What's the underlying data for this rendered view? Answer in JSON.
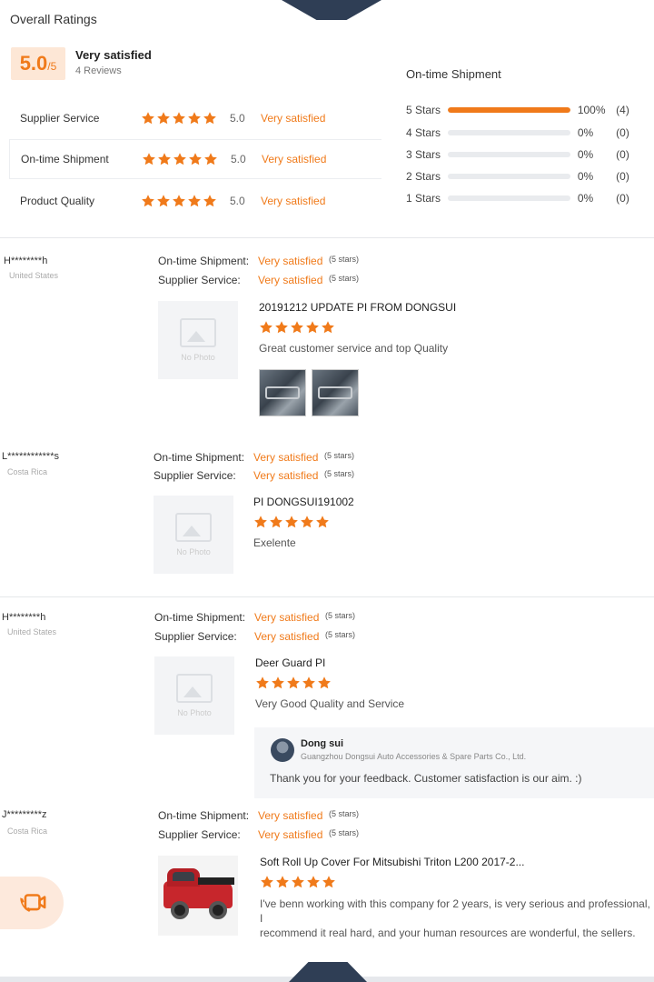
{
  "overall": {
    "title": "Overall Ratings",
    "score": "5.0",
    "score_max": "/5",
    "summary": "Very satisfied",
    "reviews_count": "4 Reviews"
  },
  "categories": [
    {
      "label": "Supplier Service",
      "value": "5.0",
      "text": "Very satisfied",
      "stars": 5
    },
    {
      "label": "On-time Shipment",
      "value": "5.0",
      "text": "Very satisfied",
      "stars": 5
    },
    {
      "label": "Product Quality",
      "value": "5.0",
      "text": "Very satisfied",
      "stars": 5
    }
  ],
  "distribution": {
    "title": "On-time Shipment",
    "rows": [
      {
        "label": "5 Stars",
        "percent": "100%",
        "count": "(4)",
        "fill": 1.0
      },
      {
        "label": "4 Stars",
        "percent": "0%",
        "count": "(0)",
        "fill": 0
      },
      {
        "label": "3 Stars",
        "percent": "0%",
        "count": "(0)",
        "fill": 0
      },
      {
        "label": "2 Stars",
        "percent": "0%",
        "count": "(0)",
        "fill": 0
      },
      {
        "label": "1 Stars",
        "percent": "0%",
        "count": "(0)",
        "fill": 0
      }
    ]
  },
  "colors": {
    "accent": "#f07a1a",
    "accent_bg": "#fde7d6",
    "star": "#f07a1a"
  },
  "reviews": [
    {
      "name": "H********h",
      "country": "United States",
      "shipment_label": "On-time Shipment:",
      "shipment_value": "Very satisfied",
      "shipment_stars": "(5 stars)",
      "service_label": "Supplier Service:",
      "service_value": "Very satisfied",
      "service_stars": "(5 stars)",
      "placeholder": "No Photo",
      "title": "20191212 UPDATE PI FROM DONGSUI",
      "body": "Great customer service and top Quality"
    },
    {
      "name": "L************s",
      "country": "Costa Rica",
      "shipment_label": "On-time Shipment:",
      "shipment_value": "Very satisfied",
      "shipment_stars": "(5 stars)",
      "service_label": "Supplier Service:",
      "service_value": "Very satisfied",
      "service_stars": "(5 stars)",
      "placeholder": "No Photo",
      "title": "PI DONGSUI191002",
      "body": "Exelente"
    },
    {
      "name": "H********h",
      "country": "United States",
      "shipment_label": "On-time Shipment:",
      "shipment_value": "Very satisfied",
      "shipment_stars": "(5 stars)",
      "service_label": "Supplier Service:",
      "service_value": "Very satisfied",
      "service_stars": "(5 stars)",
      "placeholder": "No Photo",
      "title": "Deer Guard PI",
      "body": "Very Good Quality and Service",
      "reply": {
        "name": "Dong sui",
        "company": "Guangzhou Dongsui Auto Accessories & Spare Parts Co., Ltd.",
        "text": "Thank you for your feedback. Customer satisfaction is our aim. :)"
      }
    },
    {
      "name": "J*********z",
      "country": "Costa Rica",
      "shipment_label": "On-time Shipment:",
      "shipment_value": "Very satisfied",
      "shipment_stars": "(5 stars)",
      "service_label": "Supplier Service:",
      "service_value": "Very satisfied",
      "service_stars": "(5 stars)",
      "title": "Soft Roll Up Cover For Mitsubishi Triton L200 2017-2...",
      "body_line1": "I've benn working with this company for 2 years, is very serious and professional, I",
      "body_line2": "recommend it real hard, and your human resources are wonderful, the sellers."
    }
  ],
  "icons": {
    "star": "star-icon",
    "video_call": "video-call-icon",
    "no_photo": "image-placeholder-icon"
  }
}
